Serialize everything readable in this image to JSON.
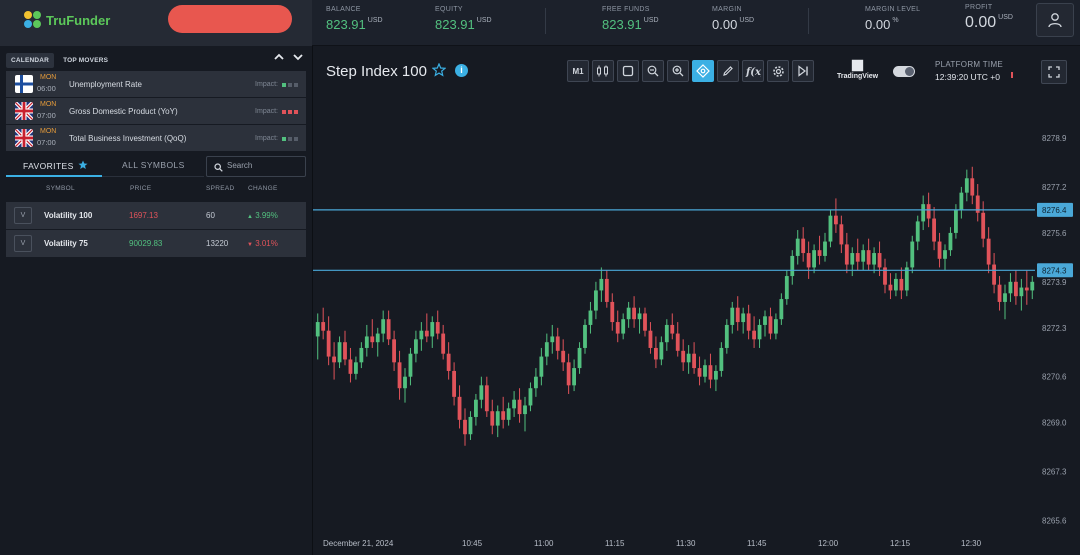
{
  "app": {
    "name": "TruFunder",
    "brand_color": "#5cc85a",
    "accent_color": "#3bb0e4"
  },
  "header": {
    "metrics": [
      {
        "key": "balance",
        "label": "BALANCE",
        "value": "823.91",
        "unit": "USD",
        "color": "green"
      },
      {
        "key": "equity",
        "label": "EQUITY",
        "value": "823.91",
        "unit": "USD",
        "color": "green"
      },
      {
        "key": "free_funds",
        "label": "FREE FUNDS",
        "value": "823.91",
        "unit": "USD",
        "color": "green"
      },
      {
        "key": "margin",
        "label": "MARGIN",
        "value": "0.00",
        "unit": "USD",
        "color": "white"
      },
      {
        "key": "margin_level",
        "label": "MARGIN LEVEL",
        "value": "0.00",
        "unit": "%",
        "color": "white"
      },
      {
        "key": "profit",
        "label": "PROFIT",
        "value": "0.00",
        "unit": "USD",
        "color": "white"
      }
    ],
    "user_icon": "user-icon"
  },
  "left_panel": {
    "tabs": [
      "CALENDAR",
      "TOP MOVERS"
    ],
    "calendar": [
      {
        "flag": "finland",
        "day": "MON",
        "time": "06:00",
        "name": "Unemployment Rate",
        "impact_label": "Impact:",
        "impact_level": 1
      },
      {
        "flag": "uk",
        "day": "MON",
        "time": "07:00",
        "name": "Gross Domestic Product (YoY)",
        "impact_label": "Impact:",
        "impact_level": 3
      },
      {
        "flag": "uk",
        "day": "MON",
        "time": "07:00",
        "name": "Total Business Investment (QoQ)",
        "impact_label": "Impact:",
        "impact_level": 1
      }
    ],
    "symbol_tabs": {
      "favorites": "FAVORITES",
      "all": "ALL SYMBOLS"
    },
    "search": {
      "placeholder": "Search",
      "value": ""
    },
    "table_headers": [
      "SYMBOL",
      "PRICE",
      "SPREAD",
      "CHANGE"
    ],
    "symbols": [
      {
        "badge": "V",
        "name": "Volatility 100",
        "price": "1697.13",
        "price_dir": "down",
        "spread": "60",
        "change": "3.99%",
        "change_dir": "up"
      },
      {
        "badge": "V",
        "name": "Volatility 75",
        "price": "90029.83",
        "price_dir": "up",
        "spread": "13220",
        "change": "3.01%",
        "change_dir": "down"
      }
    ]
  },
  "chart_panel": {
    "title": "Step Index 100",
    "toolbar": {
      "timeframe": "M1",
      "buttons": [
        "candles-icon",
        "crop-icon",
        "zoom-out-icon",
        "zoom-in-icon",
        "crosshair-icon",
        "pencil-icon",
        "fx-icon",
        "gear-icon",
        "skip-end-icon"
      ],
      "active": "crosshair-icon"
    },
    "tradingview_label": "TradingView",
    "platform_time_label": "PLATFORM TIME",
    "platform_time": "12:39:20 UTC +0"
  },
  "chart_data": {
    "type": "candlestick",
    "y_ticks": [
      "8265.6",
      "8267.3",
      "8269.0",
      "8270.6",
      "8272.3",
      "8273.9",
      "8275.6",
      "8277.2",
      "8278.9"
    ],
    "x_ticks": [
      "December 21, 2024",
      "10:45",
      "11:00",
      "11:15",
      "11:30",
      "11:45",
      "12:00",
      "12:15",
      "12:30"
    ],
    "ylim": [
      8265.2,
      8280.5
    ],
    "horizontal_lines": [
      {
        "value": "8276.4",
        "color": "#4aa8d8"
      },
      {
        "value": "8274.3",
        "color": "#4aa8d8"
      }
    ],
    "up_color": "#52c07f",
    "down_color": "#e0535a",
    "grid": false,
    "candles": [
      [
        8272.0,
        8272.8,
        8271.2,
        8272.5
      ],
      [
        8272.5,
        8273.0,
        8271.9,
        8272.2
      ],
      [
        8272.2,
        8272.7,
        8271.0,
        8271.3
      ],
      [
        8271.3,
        8271.8,
        8270.5,
        8271.1
      ],
      [
        8271.1,
        8272.0,
        8270.9,
        8271.8
      ],
      [
        8271.8,
        8272.2,
        8271.0,
        8271.2
      ],
      [
        8271.2,
        8271.6,
        8270.4,
        8270.7
      ],
      [
        8270.7,
        8271.3,
        8270.5,
        8271.1
      ],
      [
        8271.1,
        8271.8,
        8270.9,
        8271.6
      ],
      [
        8271.6,
        8272.4,
        8271.3,
        8272.0
      ],
      [
        8272.0,
        8272.6,
        8271.6,
        8271.8
      ],
      [
        8271.8,
        8272.3,
        8271.3,
        8272.1
      ],
      [
        8272.1,
        8272.9,
        8271.8,
        8272.6
      ],
      [
        8272.6,
        8272.9,
        8271.7,
        8271.9
      ],
      [
        8271.9,
        8272.2,
        8270.8,
        8271.1
      ],
      [
        8271.1,
        8271.5,
        8269.8,
        8270.2
      ],
      [
        8270.2,
        8270.9,
        8269.7,
        8270.6
      ],
      [
        8270.6,
        8271.6,
        8270.3,
        8271.4
      ],
      [
        8271.4,
        8272.2,
        8271.1,
        8271.9
      ],
      [
        8271.9,
        8272.5,
        8271.5,
        8272.2
      ],
      [
        8272.2,
        8272.8,
        8271.8,
        8272.0
      ],
      [
        8272.0,
        8272.7,
        8271.6,
        8272.5
      ],
      [
        8272.5,
        8272.9,
        8271.9,
        8272.1
      ],
      [
        8272.1,
        8272.4,
        8271.2,
        8271.4
      ],
      [
        8271.4,
        8271.8,
        8270.5,
        8270.8
      ],
      [
        8270.8,
        8271.1,
        8269.6,
        8269.9
      ],
      [
        8269.9,
        8270.3,
        8268.8,
        8269.1
      ],
      [
        8269.1,
        8269.5,
        8268.2,
        8268.6
      ],
      [
        8268.6,
        8269.4,
        8268.4,
        8269.2
      ],
      [
        8269.2,
        8270.0,
        8268.9,
        8269.8
      ],
      [
        8269.8,
        8270.6,
        8269.5,
        8270.3
      ],
      [
        8270.3,
        8270.6,
        8269.2,
        8269.4
      ],
      [
        8269.4,
        8269.8,
        8268.6,
        8268.9
      ],
      [
        8268.9,
        8269.6,
        8268.5,
        8269.4
      ],
      [
        8269.4,
        8269.9,
        8268.8,
        8269.1
      ],
      [
        8269.1,
        8269.7,
        8268.9,
        8269.5
      ],
      [
        8269.5,
        8270.1,
        8269.2,
        8269.8
      ],
      [
        8269.8,
        8270.2,
        8269.0,
        8269.3
      ],
      [
        8269.3,
        8269.9,
        8268.7,
        8269.6
      ],
      [
        8269.6,
        8270.4,
        8269.4,
        8270.2
      ],
      [
        8270.2,
        8270.9,
        8269.9,
        8270.6
      ],
      [
        8270.6,
        8271.6,
        8270.3,
        8271.3
      ],
      [
        8271.3,
        8272.1,
        8271.0,
        8271.8
      ],
      [
        8271.8,
        8272.4,
        8271.4,
        8272.0
      ],
      [
        8272.0,
        8272.3,
        8271.2,
        8271.5
      ],
      [
        8271.5,
        8271.9,
        8270.8,
        8271.1
      ],
      [
        8271.1,
        8271.4,
        8270.0,
        8270.3
      ],
      [
        8270.3,
        8271.2,
        8270.1,
        8270.9
      ],
      [
        8270.9,
        8271.8,
        8270.7,
        8271.6
      ],
      [
        8271.6,
        8272.6,
        8271.4,
        8272.4
      ],
      [
        8272.4,
        8273.2,
        8272.1,
        8272.9
      ],
      [
        8272.9,
        8273.9,
        8272.6,
        8273.6
      ],
      [
        8273.6,
        8274.4,
        8273.2,
        8274.0
      ],
      [
        8274.0,
        8274.3,
        8273.0,
        8273.2
      ],
      [
        8273.2,
        8273.5,
        8272.2,
        8272.5
      ],
      [
        8272.5,
        8272.9,
        8271.8,
        8272.1
      ],
      [
        8272.1,
        8272.8,
        8271.9,
        8272.6
      ],
      [
        8272.6,
        8273.2,
        8272.3,
        8273.0
      ],
      [
        8273.0,
        8273.4,
        8272.3,
        8272.6
      ],
      [
        8272.6,
        8273.0,
        8272.1,
        8272.8
      ],
      [
        8272.8,
        8273.0,
        8272.0,
        8272.2
      ],
      [
        8272.2,
        8272.5,
        8271.4,
        8271.6
      ],
      [
        8271.6,
        8272.0,
        8270.9,
        8271.2
      ],
      [
        8271.2,
        8272.0,
        8271.0,
        8271.8
      ],
      [
        8271.8,
        8272.6,
        8271.5,
        8272.4
      ],
      [
        8272.4,
        8272.8,
        8271.9,
        8272.1
      ],
      [
        8272.1,
        8272.5,
        8271.3,
        8271.5
      ],
      [
        8271.5,
        8271.9,
        8270.8,
        8271.1
      ],
      [
        8271.1,
        8271.7,
        8270.7,
        8271.4
      ],
      [
        8271.4,
        8271.8,
        8270.7,
        8270.9
      ],
      [
        8270.9,
        8271.3,
        8270.3,
        8270.6
      ],
      [
        8270.6,
        8271.2,
        8270.4,
        8271.0
      ],
      [
        8271.0,
        8271.4,
        8270.2,
        8270.5
      ],
      [
        8270.5,
        8271.0,
        8270.1,
        8270.8
      ],
      [
        8270.8,
        8271.8,
        8270.6,
        8271.6
      ],
      [
        8271.6,
        8272.6,
        8271.4,
        8272.4
      ],
      [
        8272.4,
        8273.2,
        8272.1,
        8273.0
      ],
      [
        8273.0,
        8273.4,
        8272.2,
        8272.5
      ],
      [
        8272.5,
        8273.0,
        8272.1,
        8272.8
      ],
      [
        8272.8,
        8273.1,
        8271.9,
        8272.2
      ],
      [
        8272.2,
        8272.7,
        8271.6,
        8271.9
      ],
      [
        8271.9,
        8272.6,
        8271.6,
        8272.4
      ],
      [
        8272.4,
        8272.9,
        8272.0,
        8272.7
      ],
      [
        8272.7,
        8273.0,
        8271.9,
        8272.1
      ],
      [
        8272.1,
        8272.8,
        8271.9,
        8272.6
      ],
      [
        8272.6,
        8273.5,
        8272.4,
        8273.3
      ],
      [
        8273.3,
        8274.3,
        8273.1,
        8274.1
      ],
      [
        8274.1,
        8275.0,
        8273.8,
        8274.8
      ],
      [
        8274.8,
        8275.7,
        8274.5,
        8275.4
      ],
      [
        8275.4,
        8275.8,
        8274.6,
        8274.9
      ],
      [
        8274.9,
        8275.3,
        8274.0,
        8274.4
      ],
      [
        8274.4,
        8275.2,
        8274.2,
        8275.0
      ],
      [
        8275.0,
        8275.5,
        8274.5,
        8274.8
      ],
      [
        8274.8,
        8275.6,
        8274.6,
        8275.3
      ],
      [
        8275.3,
        8276.4,
        8275.1,
        8276.2
      ],
      [
        8276.2,
        8276.8,
        8275.6,
        8275.9
      ],
      [
        8275.9,
        8276.2,
        8274.9,
        8275.2
      ],
      [
        8275.2,
        8275.6,
        8274.2,
        8274.5
      ],
      [
        8274.5,
        8275.1,
        8274.1,
        8274.9
      ],
      [
        8274.9,
        8275.4,
        8274.3,
        8274.6
      ],
      [
        8274.6,
        8275.2,
        8274.3,
        8275.0
      ],
      [
        8275.0,
        8275.4,
        8274.3,
        8274.5
      ],
      [
        8274.5,
        8275.1,
        8274.2,
        8274.9
      ],
      [
        8274.9,
        8275.3,
        8274.1,
        8274.4
      ],
      [
        8274.4,
        8274.7,
        8273.5,
        8273.8
      ],
      [
        8273.8,
        8274.2,
        8273.3,
        8273.6
      ],
      [
        8273.6,
        8274.2,
        8273.4,
        8274.0
      ],
      [
        8274.0,
        8274.4,
        8273.3,
        8273.6
      ],
      [
        8273.6,
        8274.6,
        8273.4,
        8274.4
      ],
      [
        8274.4,
        8275.5,
        8274.2,
        8275.3
      ],
      [
        8275.3,
        8276.2,
        8275.0,
        8276.0
      ],
      [
        8276.0,
        8276.9,
        8275.7,
        8276.6
      ],
      [
        8276.6,
        8277.0,
        8275.8,
        8276.1
      ],
      [
        8276.1,
        8276.5,
        8275.0,
        8275.3
      ],
      [
        8275.3,
        8275.6,
        8274.4,
        8274.7
      ],
      [
        8274.7,
        8275.2,
        8274.3,
        8275.0
      ],
      [
        8275.0,
        8275.8,
        8274.8,
        8275.6
      ],
      [
        8275.6,
        8276.6,
        8275.4,
        8276.4
      ],
      [
        8276.4,
        8277.2,
        8276.1,
        8277.0
      ],
      [
        8277.0,
        8277.8,
        8276.7,
        8277.5
      ],
      [
        8277.5,
        8277.9,
        8276.6,
        8276.9
      ],
      [
        8276.9,
        8277.3,
        8276.0,
        8276.3
      ],
      [
        8276.3,
        8276.7,
        8275.1,
        8275.4
      ],
      [
        8275.4,
        8275.8,
        8274.2,
        8274.5
      ],
      [
        8274.5,
        8274.9,
        8273.5,
        8273.8
      ],
      [
        8273.8,
        8274.1,
        8272.9,
        8273.2
      ],
      [
        8273.2,
        8273.8,
        8272.6,
        8273.5
      ],
      [
        8273.5,
        8274.2,
        8273.2,
        8273.9
      ],
      [
        8273.9,
        8274.3,
        8273.1,
        8273.4
      ],
      [
        8273.4,
        8274.0,
        8272.9,
        8273.7
      ],
      [
        8273.7,
        8274.3,
        8273.1,
        8273.6
      ],
      [
        8273.6,
        8274.1,
        8273.3,
        8273.9
      ]
    ]
  }
}
